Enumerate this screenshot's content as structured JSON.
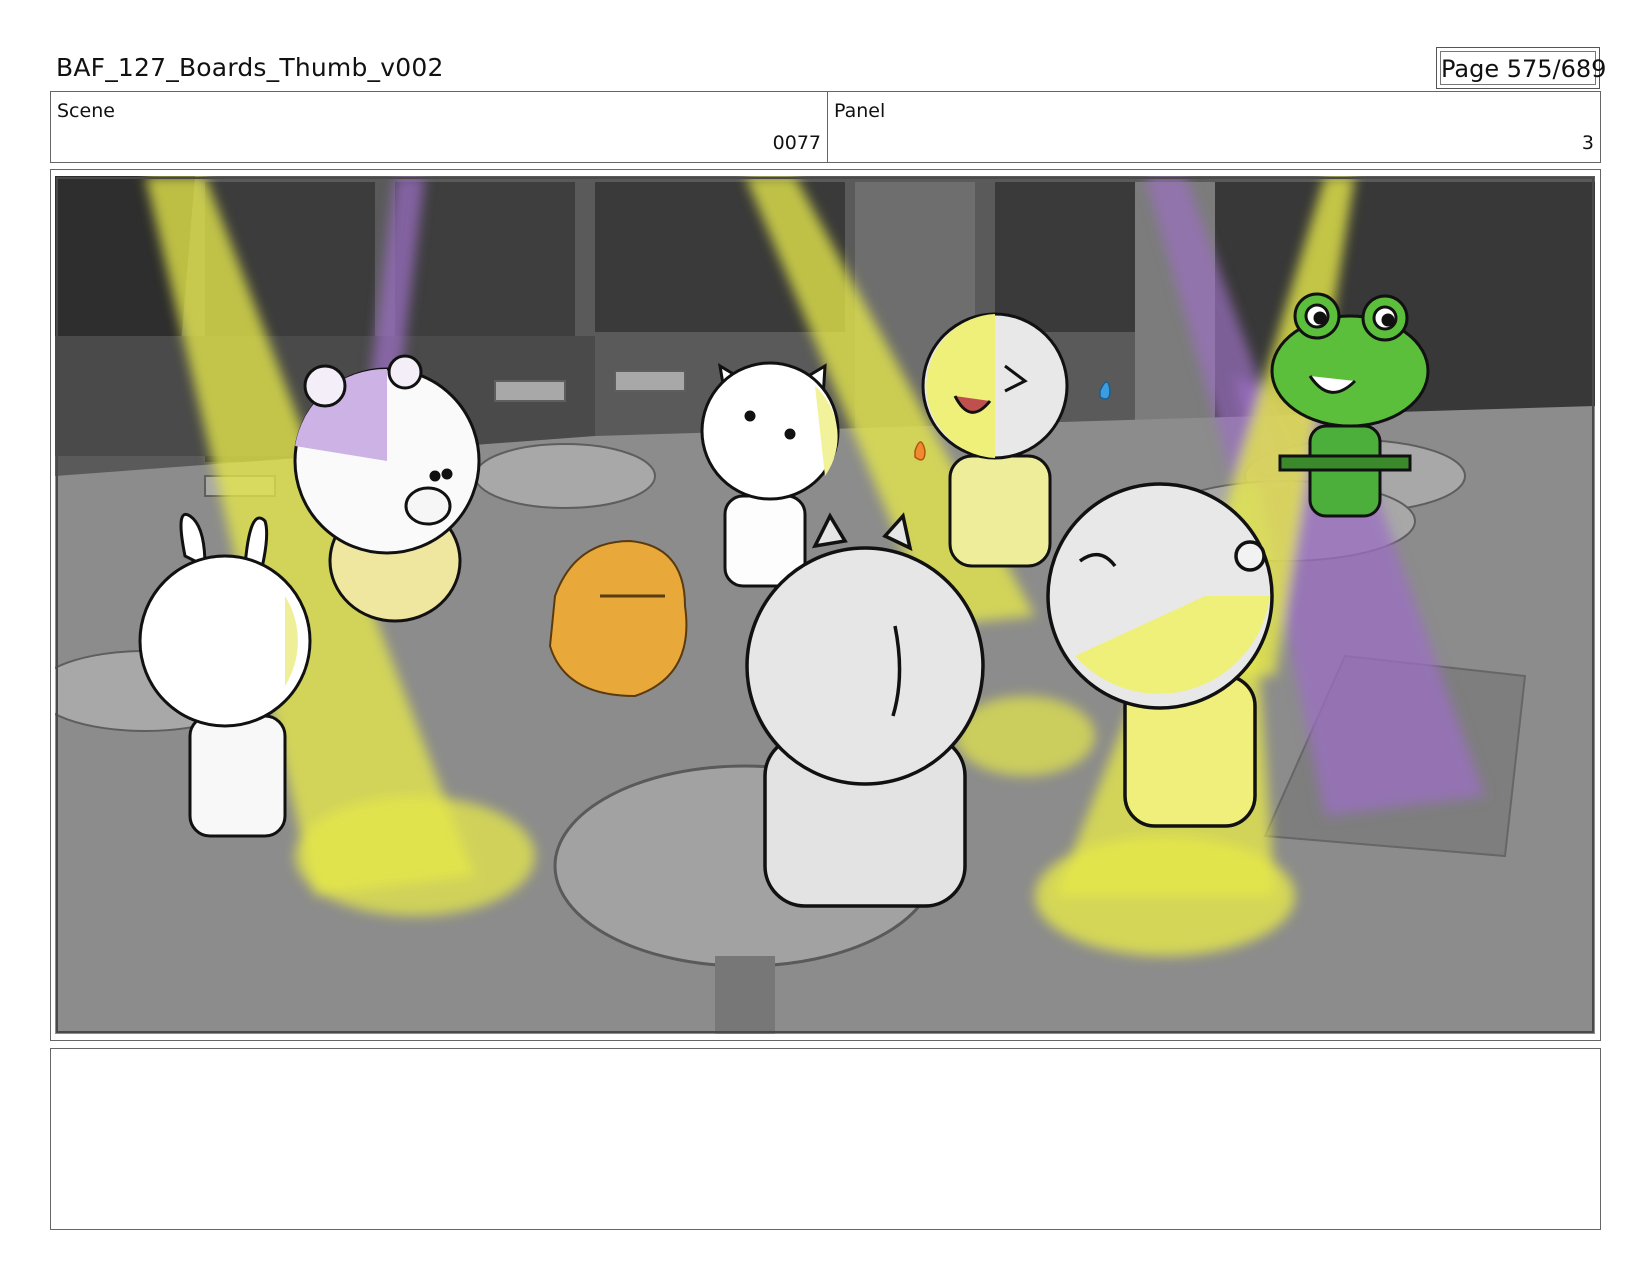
{
  "header": {
    "document_title": "BAF_127_Boards_Thumb_v002",
    "page_label": "Page 575/689"
  },
  "info": {
    "scene_label": "Scene",
    "scene_value": "0077",
    "panel_label": "Panel",
    "panel_value": "3"
  },
  "frame": {
    "description_icon": "storyboard-drawing-icon"
  },
  "colors": {
    "border": "#666666",
    "spotlight_yellow": "#e6e84a",
    "spotlight_purple": "#9b6fc2",
    "frog_green": "#4caf3c",
    "orange_character": "#e8a83a"
  }
}
